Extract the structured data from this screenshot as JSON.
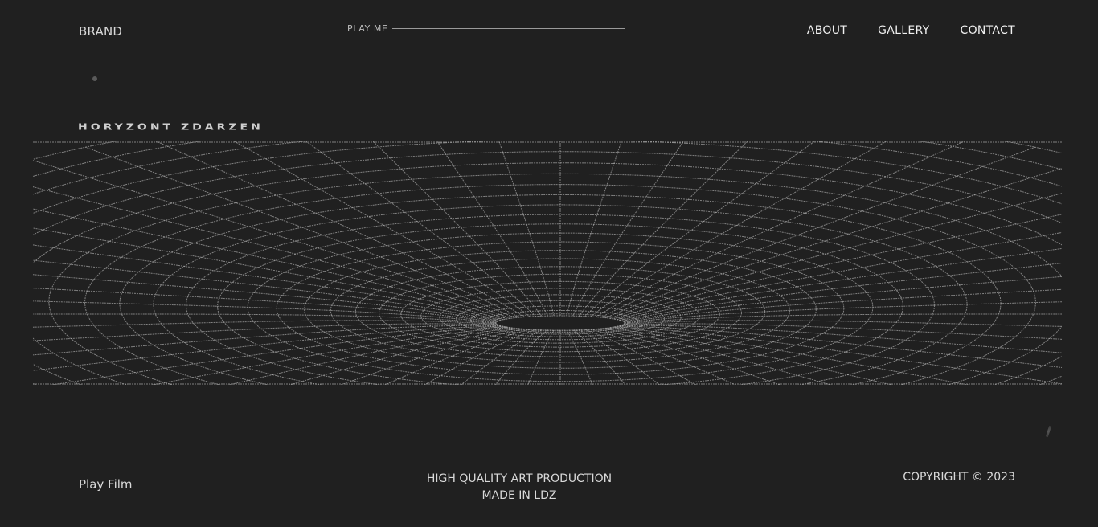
{
  "header": {
    "brand": "BRAND",
    "player_label": "PLAY ME",
    "nav": [
      "ABOUT",
      "GALLERY",
      "CONTACT"
    ]
  },
  "hero": {
    "title": "HORYZONT ZDARZEN"
  },
  "footer": {
    "play_film": "Play Film",
    "tagline_line1": "HIGH QUALITY ART PRODUCTION",
    "tagline_line2": "MADE IN LDZ",
    "copyright": "COPYRIGHT © 2023"
  },
  "colors": {
    "background": "#202020",
    "text": "#d9d9d9",
    "grid": "#bdbdbd"
  },
  "icons": [
    "wormhole-grid-graphic"
  ]
}
